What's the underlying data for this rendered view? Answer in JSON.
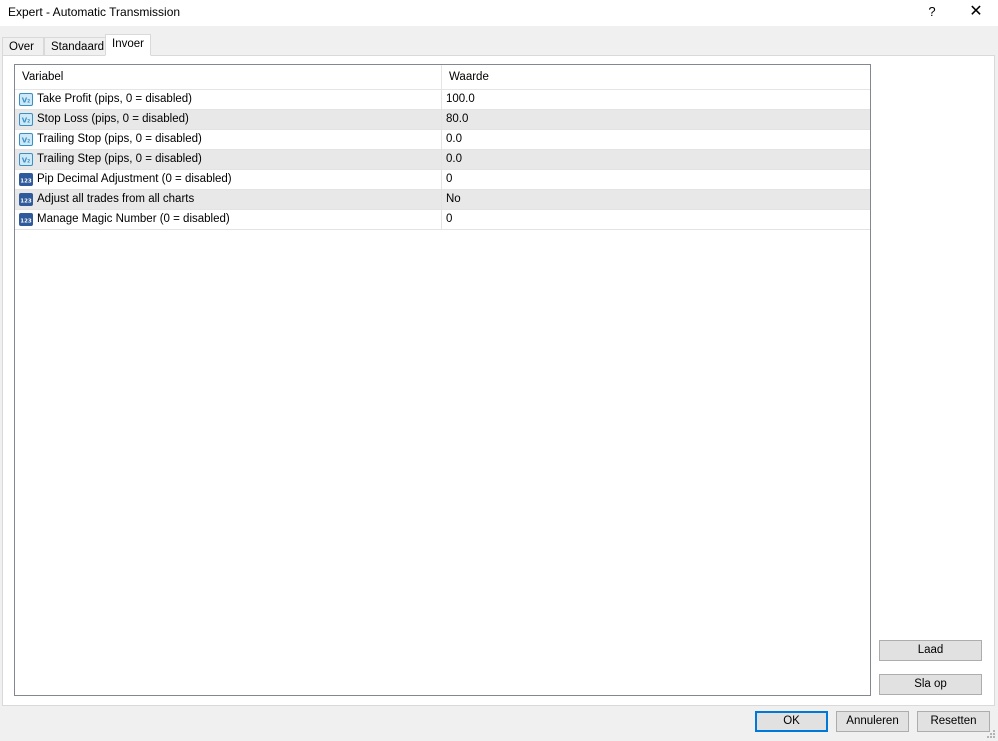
{
  "window": {
    "title": "Expert - Automatic Transmission",
    "help_label": "?",
    "close_label": "✕"
  },
  "tabs": [
    {
      "label": "Over",
      "active": false
    },
    {
      "label": "Standaard",
      "active": false
    },
    {
      "label": "Invoer",
      "active": true
    }
  ],
  "grid": {
    "headers": {
      "variable": "Variabel",
      "value": "Waarde"
    },
    "rows": [
      {
        "icon": "double-value-icon",
        "icon_text": "V₂",
        "name": "Take Profit (pips, 0 = disabled)",
        "value": "100.0"
      },
      {
        "icon": "double-value-icon",
        "icon_text": "V₂",
        "name": "Stop Loss (pips, 0 = disabled)",
        "value": "80.0"
      },
      {
        "icon": "double-value-icon",
        "icon_text": "V₂",
        "name": "Trailing Stop (pips, 0 = disabled)",
        "value": "0.0"
      },
      {
        "icon": "double-value-icon",
        "icon_text": "V₂",
        "name": "Trailing Step (pips, 0 = disabled)",
        "value": "0.0"
      },
      {
        "icon": "integer-value-icon",
        "icon_text": "123",
        "name": "Pip Decimal Adjustment (0 = disabled)",
        "value": "0"
      },
      {
        "icon": "integer-value-icon",
        "icon_text": "123",
        "name": "Adjust all trades from all charts",
        "value": "No"
      },
      {
        "icon": "integer-value-icon",
        "icon_text": "123",
        "name": "Manage Magic Number (0 = disabled)",
        "value": "0"
      }
    ]
  },
  "side_buttons": {
    "load": "Laad",
    "save": "Sla op"
  },
  "bottom_buttons": {
    "ok": "OK",
    "cancel": "Annuleren",
    "reset": "Resetten"
  },
  "colors": {
    "icon_double_bg": "#cde8f6",
    "icon_double_border": "#3a8fc4",
    "icon_int_bg": "#2f5a9c",
    "ok_border": "#0078d7"
  }
}
